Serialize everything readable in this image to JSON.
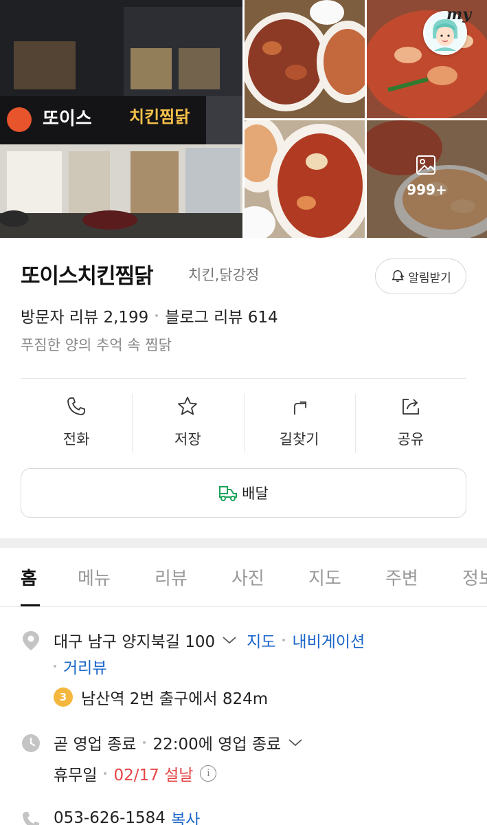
{
  "gallery": {
    "sign_text": "또이스",
    "sign_text2": "치킨찜닭",
    "photo_count": "999+",
    "my_badge": "my"
  },
  "place": {
    "name": "또이스치킨찜닭",
    "category": "치킨,닭강정",
    "alarm_label": "알림받기",
    "visitor_reviews_label": "방문자 리뷰",
    "visitor_reviews_count": "2,199",
    "blog_reviews_label": "블로그 리뷰",
    "blog_reviews_count": "614",
    "tagline": "푸짐한 양의 추억 속 찜닭"
  },
  "actions": [
    {
      "label": "전화",
      "icon": "phone-icon"
    },
    {
      "label": "저장",
      "icon": "star-icon"
    },
    {
      "label": "길찾기",
      "icon": "directions-icon"
    },
    {
      "label": "공유",
      "icon": "share-icon"
    }
  ],
  "delivery": {
    "label": "배달",
    "icon": "delivery-scooter-icon"
  },
  "tabs": [
    "홈",
    "메뉴",
    "리뷰",
    "사진",
    "지도",
    "주변",
    "정보"
  ],
  "details": {
    "address": "대구 남구 양지북길 100",
    "map_link": "지도",
    "navigation_link": "내비게이션",
    "street_view_link": "거리뷰",
    "subway_line": "3",
    "subway_text": "남산역 2번 출구에서 824m",
    "status": "곧 영업 종료",
    "hours": "22:00에 영업 종료",
    "holiday_label": "휴무일",
    "holiday_value": "02/17 설날",
    "phone": "053-626-1584",
    "copy_label": "복사"
  },
  "colors": {
    "link": "#1b66c9",
    "holiday_red": "#e64545",
    "subway_line3": "#f4b73d",
    "delivery_green": "#1aa35b"
  }
}
